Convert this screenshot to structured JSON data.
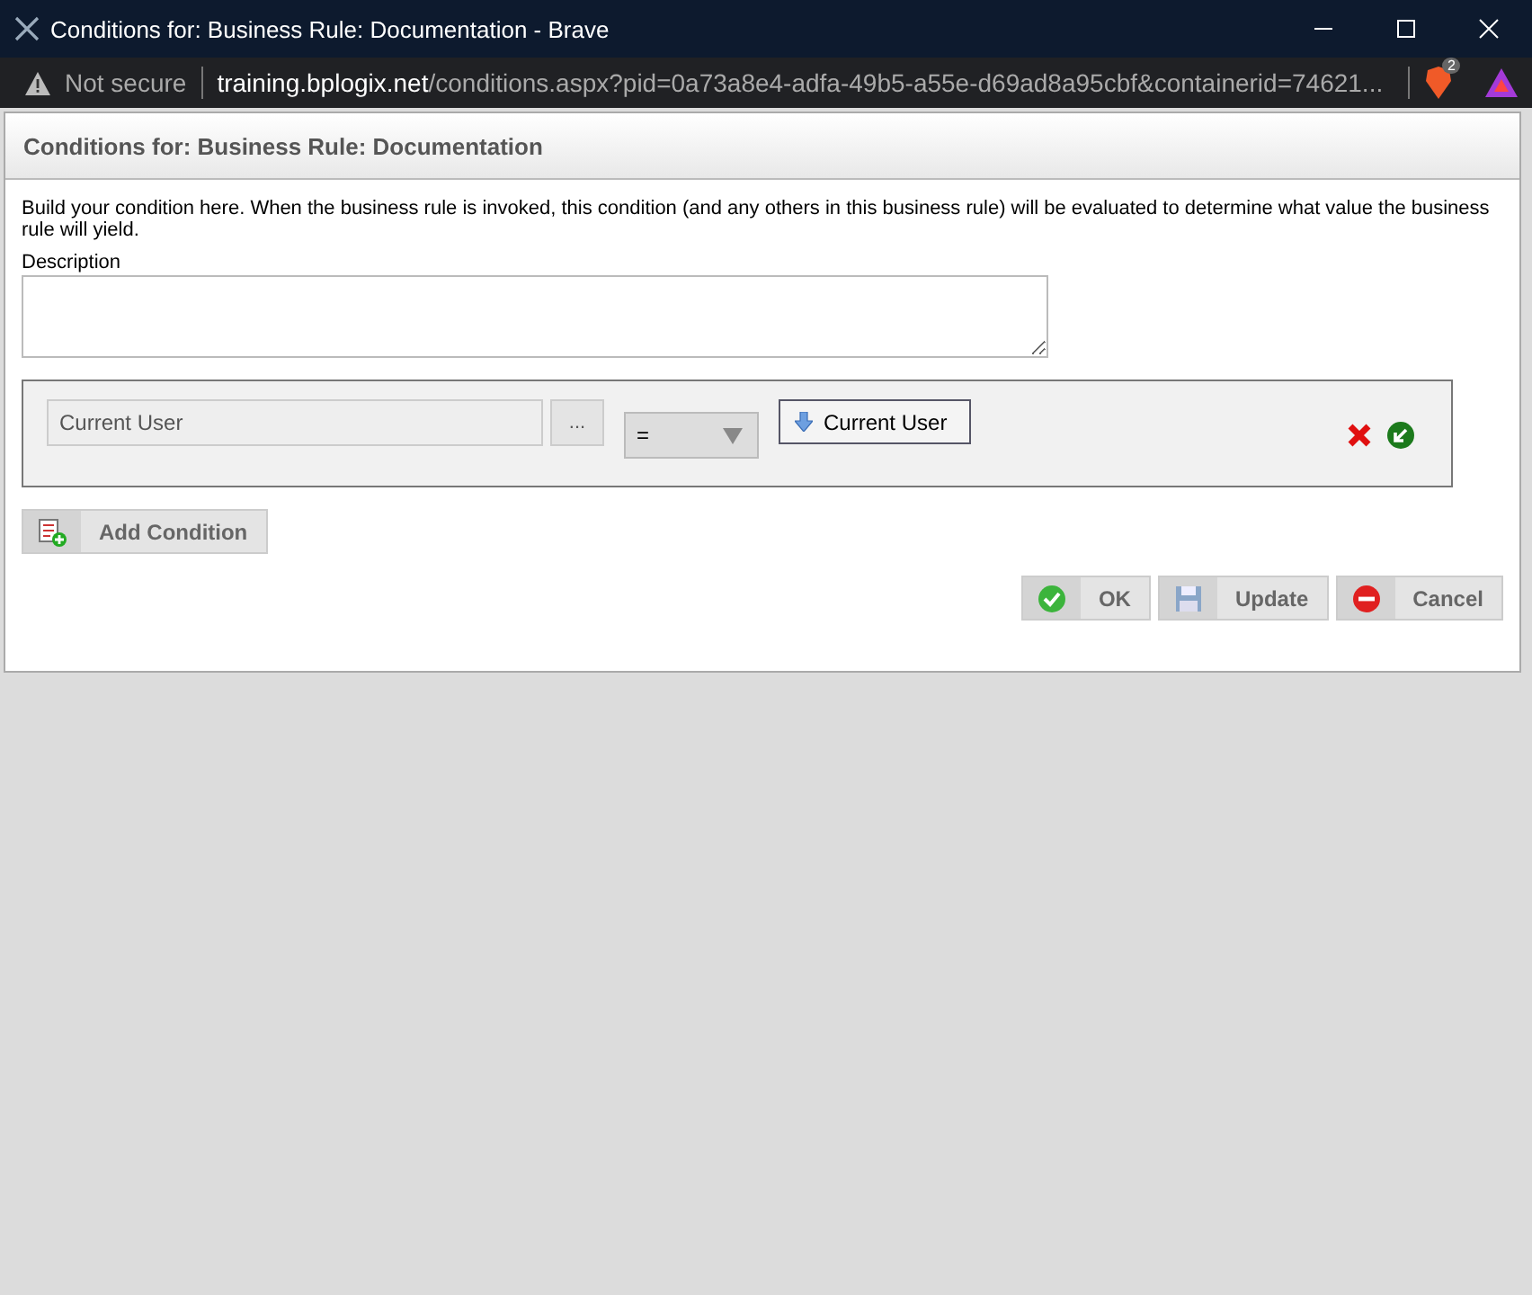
{
  "window": {
    "title": "Conditions for: Business Rule: Documentation - Brave"
  },
  "address_bar": {
    "security": "Not secure",
    "domain": "training.bplogix.net",
    "path": "/conditions.aspx?pid=0a73a8e4-adfa-49b5-a55e-d69ad8a95cbf&containerid=74621...",
    "shield_badge": "2"
  },
  "dialog": {
    "heading": "Conditions for: Business Rule: Documentation",
    "intro": "Build your condition here. When the business rule is invoked, this condition (and any others in this business rule) will be evaluated to determine what value the business rule will yield.",
    "description_label": "Description",
    "condition": {
      "left_value": "Current User",
      "browse": "...",
      "operator": "=",
      "right_value": "Current User"
    },
    "add_condition": "Add Condition",
    "buttons": [
      {
        "kind": "ok",
        "label": "OK"
      },
      {
        "kind": "update",
        "label": "Update"
      },
      {
        "kind": "cancel",
        "label": "Cancel"
      }
    ]
  }
}
